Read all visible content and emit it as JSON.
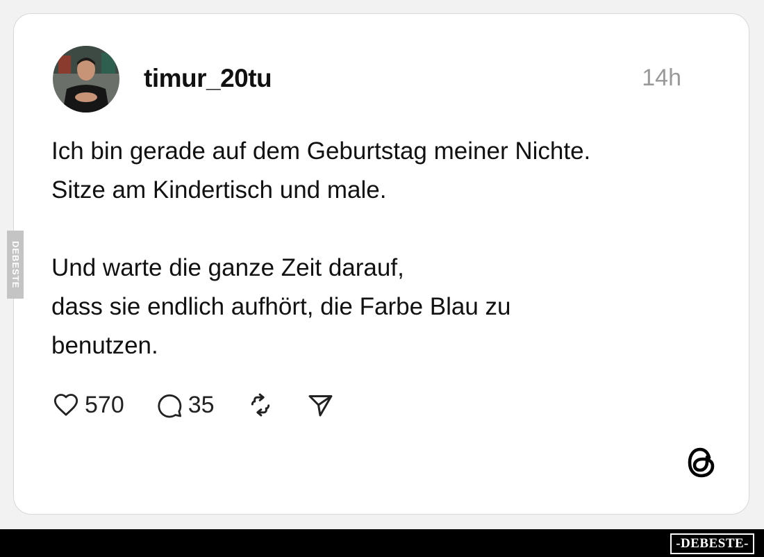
{
  "post": {
    "username": "timur_20tu",
    "timestamp": "14h",
    "paragraphs": [
      [
        "Ich bin gerade auf dem Geburtstag meiner Nichte.",
        "Sitze am Kindertisch und male."
      ],
      [
        "Und warte die ganze Zeit darauf,",
        "dass sie endlich aufhört, die Farbe Blau zu",
        "benutzen."
      ]
    ],
    "likes": "570",
    "comments": "35"
  },
  "icons": {
    "like": "heart-icon",
    "comment": "speech-bubble-icon",
    "repost": "repost-icon",
    "share": "send-icon",
    "platform": "threads-logo-icon"
  },
  "watermark": {
    "side": "DEBESTE",
    "footer": "-DEBESTE-"
  }
}
